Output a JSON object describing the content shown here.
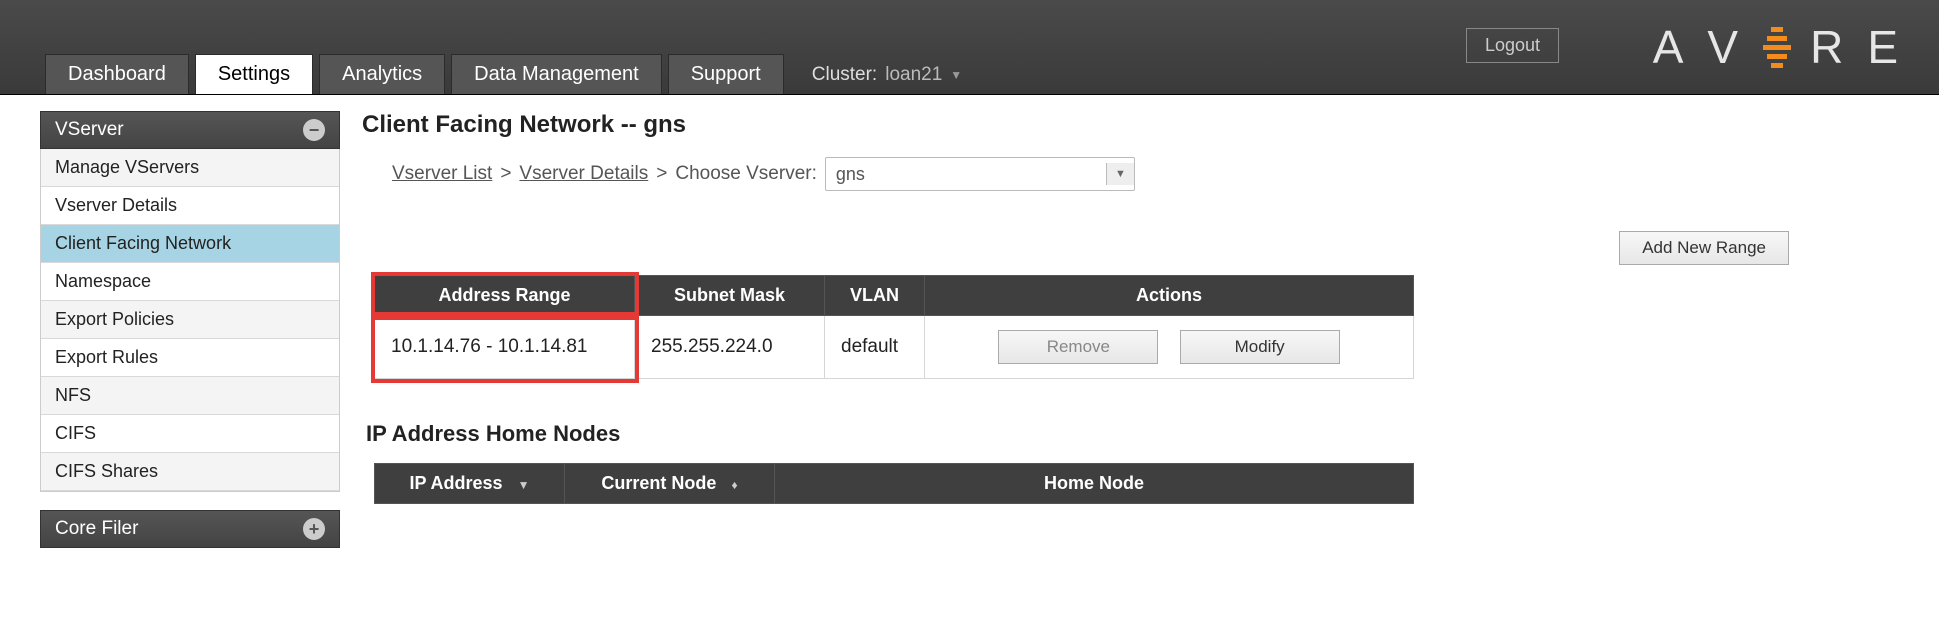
{
  "header": {
    "logout_label": "Logout",
    "logo_letters": [
      "A",
      "V",
      "R",
      "E"
    ],
    "tabs": [
      "Dashboard",
      "Settings",
      "Analytics",
      "Data Management",
      "Support"
    ],
    "active_tab": "Settings",
    "cluster_prefix": "Cluster:",
    "cluster_name": "loan21"
  },
  "sidebar": {
    "groups": [
      {
        "title": "VServer",
        "icon": "minus",
        "items": [
          "Manage VServers",
          "Vserver Details",
          "Client Facing Network",
          "Namespace",
          "Export Policies",
          "Export Rules",
          "NFS",
          "CIFS",
          "CIFS Shares"
        ],
        "active_item": "Client Facing Network"
      },
      {
        "title": "Core Filer",
        "icon": "plus",
        "items": []
      }
    ]
  },
  "main": {
    "page_title": "Client Facing Network -- gns",
    "breadcrumb": {
      "link1": "Vserver List",
      "link2": "Vserver Details",
      "choose_label": "Choose Vserver:",
      "selected_vserver": "gns"
    },
    "add_range_label": "Add New Range",
    "range_table": {
      "headers": [
        "Address Range",
        "Subnet Mask",
        "VLAN",
        "Actions"
      ],
      "rows": [
        {
          "address_range": "10.1.14.76 - 10.1.14.81",
          "subnet_mask": "255.255.224.0",
          "vlan": "default"
        }
      ],
      "remove_label": "Remove",
      "modify_label": "Modify"
    },
    "ip_home_title": "IP Address Home Nodes",
    "ip_home_headers": [
      "IP Address",
      "Current Node",
      "Home Node"
    ]
  }
}
